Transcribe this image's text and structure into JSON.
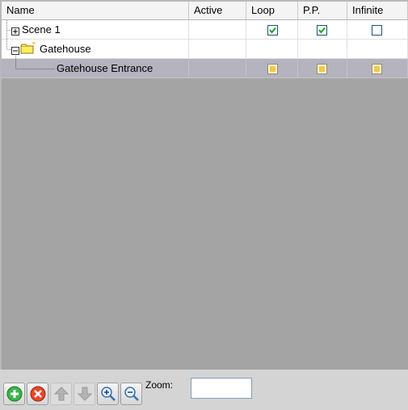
{
  "columns": {
    "name": "Name",
    "active": "Active",
    "loop": "Loop",
    "pp": "P.P.",
    "infinite": "Infinite"
  },
  "rows": [
    {
      "label": "Scene 1",
      "expander": "plus",
      "loop": "checked",
      "pp": "checked",
      "infinite": "unchecked",
      "selected": false
    },
    {
      "label": "Gatehouse",
      "expander": "minus",
      "icon": "folder-icon",
      "selected": false
    },
    {
      "label": "Gatehouse Entrance",
      "loop": "indeterminate",
      "pp": "indeterminate",
      "infinite": "indeterminate",
      "selected": true
    }
  ],
  "toolbar": {
    "zoom_label": "Zoom:",
    "zoom_value": "",
    "buttons": [
      "add-icon",
      "remove-icon",
      "move-up-icon",
      "move-down-icon",
      "zoom-in-icon",
      "zoom-out-icon"
    ]
  },
  "colors": {
    "empty_area": "#a4a4a4",
    "selected_row": "#b4b3be",
    "check_green": "#21a121",
    "indeterminate_yellow": "#f3c84a"
  }
}
